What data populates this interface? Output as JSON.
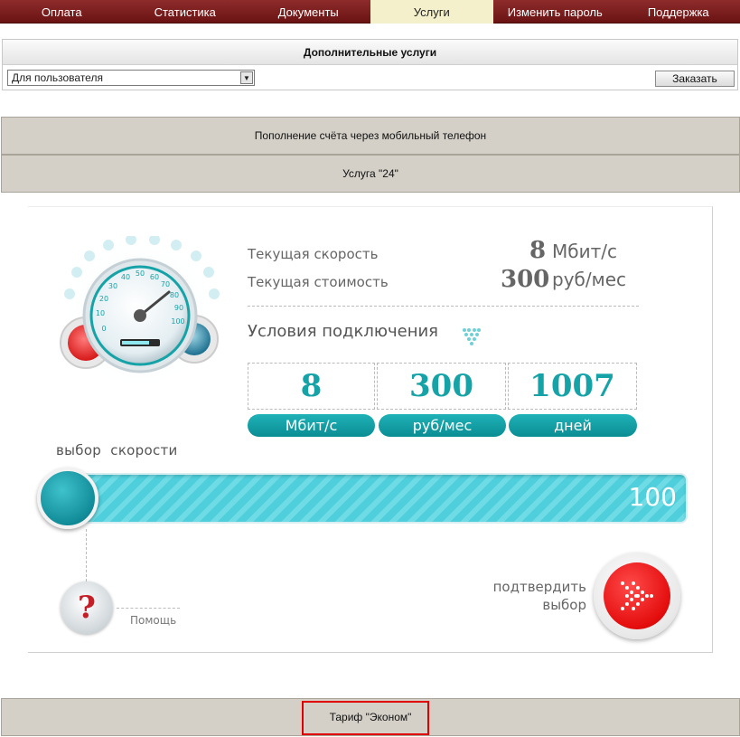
{
  "nav": {
    "items": [
      {
        "label": "Оплата"
      },
      {
        "label": "Статистика"
      },
      {
        "label": "Документы"
      },
      {
        "label": "Услуги",
        "active": true
      },
      {
        "label": "Изменить пароль"
      },
      {
        "label": "Поддержка"
      }
    ]
  },
  "services": {
    "title": "Дополнительные услуги",
    "select_value": "Для пользователя",
    "order_label": "Заказать"
  },
  "bars": {
    "mobile_topup": "Пополнение счёта через мобильный телефон",
    "service_24": "Услуга \"24\"",
    "tariff": "Тариф \"Эконом\""
  },
  "widget": {
    "current_speed_label": "Текущая скорость",
    "current_speed_value": "8",
    "current_speed_unit": "Мбит/с",
    "current_cost_label": "Текущая стоимость",
    "current_cost_value": "300",
    "current_cost_unit": "руб/мес",
    "conditions_label": "Условия подключения",
    "cond_speed_value": "8",
    "cond_speed_unit": "Мбит/с",
    "cond_cost_value": "300",
    "cond_cost_unit": "руб/мес",
    "cond_days_value": "1007",
    "cond_days_unit": "дней",
    "speed_select_label": "выбор  скорости",
    "slider_value": "100",
    "help_label": "Помощь",
    "confirm_line1": "подтвердить",
    "confirm_line2": "выбор"
  },
  "colors": {
    "nav_bg": "#7a1c1c",
    "nav_active": "#f5f0cc",
    "accent_teal": "#16a3a8",
    "confirm_red": "#e40d0d"
  }
}
